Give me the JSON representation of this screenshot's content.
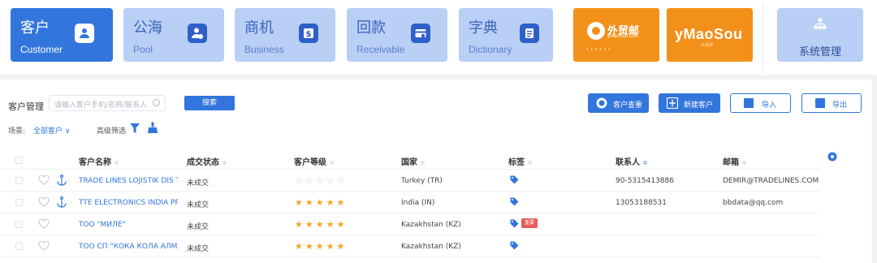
{
  "modules": [
    {
      "zh": "客户",
      "en": "Customer",
      "icon": "customer-icon",
      "active": true
    },
    {
      "zh": "公海",
      "en": "Pool",
      "icon": "pool-icon",
      "active": false
    },
    {
      "zh": "商机",
      "en": "Business",
      "icon": "business-icon",
      "active": false
    },
    {
      "zh": "回款",
      "en": "Receivable",
      "icon": "receivable-icon",
      "active": false
    },
    {
      "zh": "字典",
      "en": "Dictionary",
      "icon": "dictionary-icon",
      "active": false
    }
  ],
  "brands": {
    "waimao": {
      "title": "外贸邮",
      "sub": "yMaoSou.com"
    },
    "ymaosou": {
      "title": "yMaoSou",
      "sub": "外贸搜"
    }
  },
  "system": {
    "label": "系统管理",
    "icon": "org-chart-icon"
  },
  "toolbar": {
    "title": "客户管理",
    "search_placeholder": "请输入客户手机/名称/联系人",
    "search_button": "搜索",
    "check_button": "客户查重",
    "new_button": "新建客户",
    "import_button": "导入",
    "export_button": "导出",
    "scene_label": "场景:",
    "scene_value": "全部客户 ∨",
    "advanced_filter": "高级筛选"
  },
  "table": {
    "headers": {
      "name": "客户名称",
      "status": "成交状态",
      "level": "客户等级",
      "country": "国家",
      "tag": "标签",
      "contact": "联系人",
      "email": "邮箱"
    },
    "sort_glyph": "≑",
    "rows": [
      {
        "name": "TRADE LINES LOJISTIK DIS T...",
        "status": "未成交",
        "stars": "☆☆☆☆☆",
        "rated": false,
        "country": "Turkey (TR)",
        "contact": "90-5315413886",
        "email": "DEMIR@TRADELINES.COM.TR",
        "anchor": true,
        "badge": ""
      },
      {
        "name": "TTE ELECTRONICS INDIA PR...",
        "status": "未成交",
        "stars": "★★★★★",
        "rated": true,
        "country": "India (IN)",
        "contact": "13053188531",
        "email": "bbdata@qq.com",
        "anchor": true,
        "badge": ""
      },
      {
        "name": "ТОО \"МИЛЕ\"",
        "status": "未成交",
        "stars": "★★★★★",
        "rated": true,
        "country": "Kazakhstan (KZ)",
        "contact": "",
        "email": "",
        "anchor": false,
        "badge": "重要"
      },
      {
        "name": "ТОО СП \"КОКА КОЛА АЛМА...",
        "status": "未成交",
        "stars": "★★★★★",
        "rated": true,
        "country": "Kazakhstan (KZ)",
        "contact": "",
        "email": "",
        "anchor": false,
        "badge": ""
      }
    ]
  },
  "colors": {
    "primary": "#3275dc",
    "card": "#b9cff6",
    "brand_orange": "#f39019",
    "star": "#f5a623",
    "badge": "#e85a5a"
  }
}
